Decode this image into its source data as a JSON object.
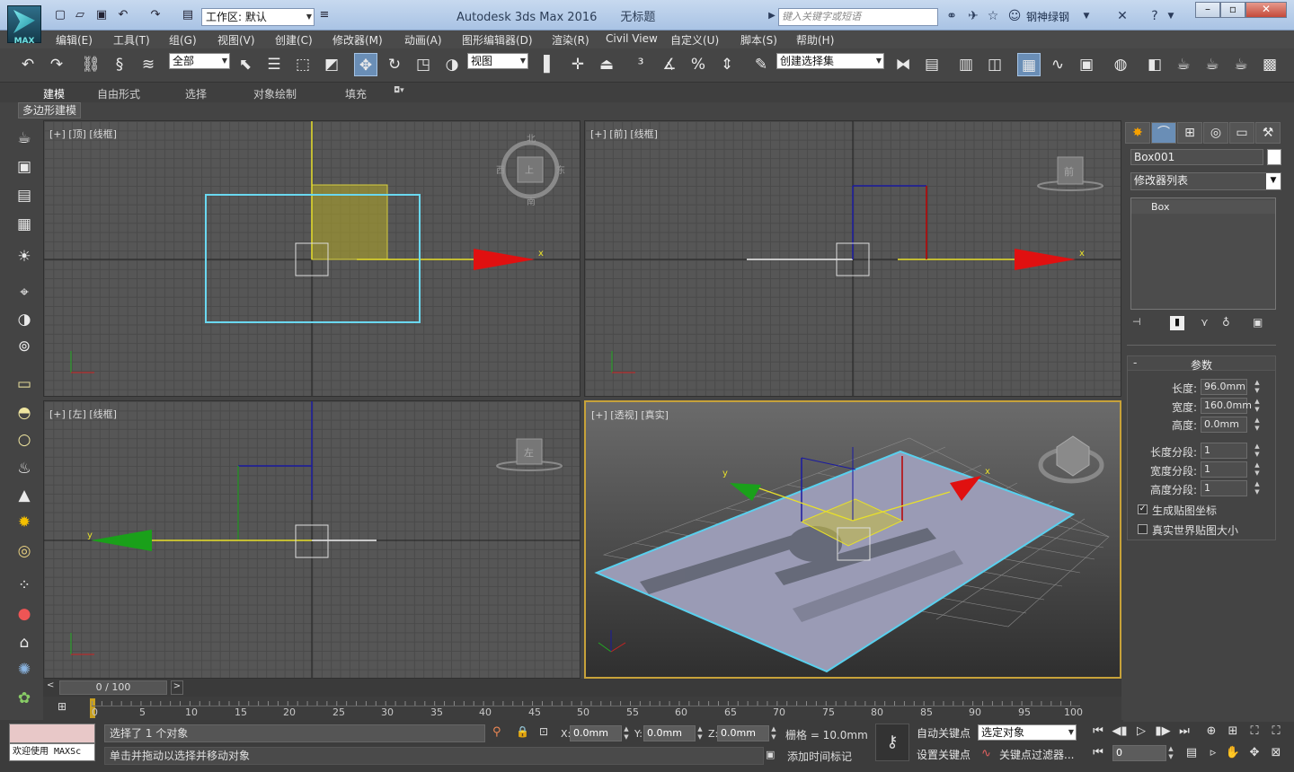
{
  "app": {
    "title": "Autodesk 3ds Max 2016",
    "doc": "无标题",
    "logo_text": "MAX"
  },
  "workspace": {
    "label": "工作区: 默认"
  },
  "search": {
    "placeholder": "键入关键字或短语"
  },
  "user": {
    "name": "钢神绿钢"
  },
  "menu": [
    "编辑(E)",
    "工具(T)",
    "组(G)",
    "视图(V)",
    "创建(C)",
    "修改器(M)",
    "动画(A)",
    "图形编辑器(D)",
    "渲染(R)",
    "Civil View",
    "自定义(U)",
    "脚本(S)",
    "帮助(H)"
  ],
  "toolbar": {
    "selection_filter": "全部",
    "ref_coord": "视图",
    "named_selection": "创建选择集"
  },
  "ribbon": {
    "tabs": [
      "建模",
      "自由形式",
      "选择",
      "对象绘制",
      "填充"
    ],
    "active": "建模",
    "sub": "多边形建模"
  },
  "viewports": {
    "top": "[+] [顶] [线框]",
    "front": "[+] [前] [线框]",
    "left": "[+] [左] [线框]",
    "persp": "[+] [透视] [真实]",
    "axis_x": "x",
    "axis_y": "y",
    "axis_z": "z",
    "cube_top": "上",
    "cube_front": "前",
    "cube_left": "左",
    "compass": {
      "n": "北",
      "s": "南",
      "e": "东",
      "w": "西"
    }
  },
  "time": {
    "frame": "0 / 100",
    "ticks": [
      "0",
      "5",
      "10",
      "15",
      "20",
      "25",
      "30",
      "35",
      "40",
      "45",
      "50",
      "55",
      "60",
      "65",
      "70",
      "75",
      "80",
      "85",
      "90",
      "95",
      "100"
    ]
  },
  "status": {
    "welcome": "欢迎使用 MAXSc",
    "selected": "选择了 1 个对象",
    "prompt": "单击并拖动以选择并移动对象",
    "x": "0.0mm",
    "y": "0.0mm",
    "z": "0.0mm",
    "grid": "栅格 = 10.0mm",
    "add_time_tag": "添加时间标记",
    "auto_key": "自动关键点",
    "set_key": "设置关键点",
    "key_mode": "选定对象",
    "key_filters": "关键点过滤器...",
    "current_frame": "0"
  },
  "command_panel": {
    "object_name": "Box001",
    "modifier_list": "修改器列表",
    "stack": [
      "Box"
    ],
    "rollout": "参数",
    "params": [
      {
        "label": "长度:",
        "value": "96.0mm"
      },
      {
        "label": "宽度:",
        "value": "160.0mm"
      },
      {
        "label": "高度:",
        "value": "0.0mm"
      },
      {
        "label": "长度分段:",
        "value": "1"
      },
      {
        "label": "宽度分段:",
        "value": "1"
      },
      {
        "label": "高度分段:",
        "value": "1"
      }
    ],
    "gen_uv": "生成贴图坐标",
    "real_world": "真实世界贴图大小"
  }
}
